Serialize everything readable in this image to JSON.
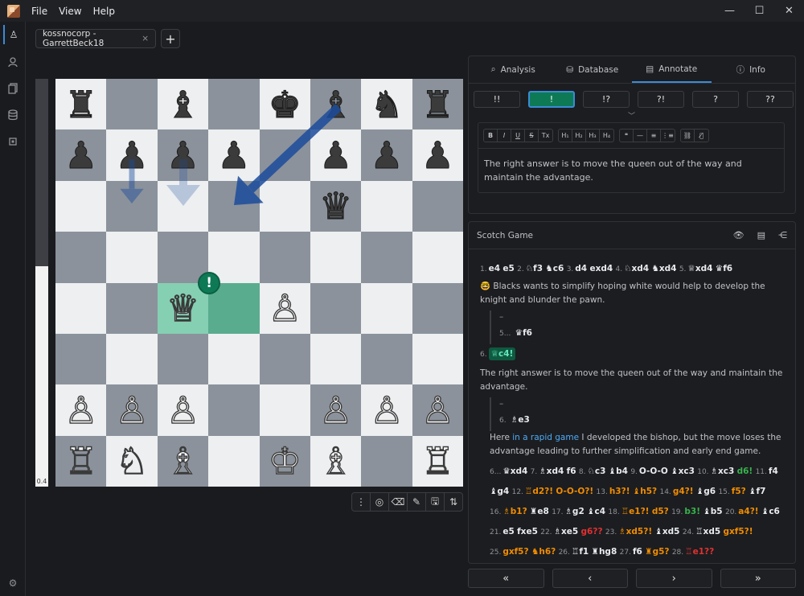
{
  "menu": [
    "File",
    "View",
    "Help"
  ],
  "tab": {
    "title": "kossnocorp - GarrettBeck18",
    "close": "×",
    "add": "+"
  },
  "eval": {
    "value": "0.4",
    "white_fraction": 0.54
  },
  "board_tools": [
    "⋮",
    "◎",
    "⌫",
    "✎",
    "🖫",
    "⇅"
  ],
  "panel": {
    "tabs": [
      {
        "icon": "⌕",
        "label": "Analysis"
      },
      {
        "icon": "⛁",
        "label": "Database"
      },
      {
        "icon": "▤",
        "label": "Annotate"
      },
      {
        "icon": "ⓘ",
        "label": "Info"
      }
    ],
    "active_tab": "Annotate",
    "nags": [
      "!!",
      "!",
      "!?",
      "?!",
      "?",
      "??"
    ],
    "selected_nag": "!",
    "editor_tools": [
      [
        "B",
        "I",
        "U",
        "S",
        "Tx"
      ],
      [
        "H₁",
        "H₂",
        "H₃",
        "H₄"
      ],
      [
        "❝",
        "—",
        "≡",
        "⋮≡"
      ],
      [
        "⛓",
        "⛓̸"
      ]
    ],
    "comment": "The right answer is to move the queen out of the way and maintain the advantage."
  },
  "game": {
    "title": "Scotch Game",
    "line1": [
      [
        "1.",
        "e4"
      ],
      [
        "",
        "e5"
      ],
      [
        "2.",
        "♘f3"
      ],
      [
        "",
        "♞c6"
      ],
      [
        "3.",
        "d4"
      ],
      [
        "",
        "exd4"
      ],
      [
        "4.",
        "♘xd4"
      ],
      [
        "",
        "♞xd4"
      ],
      [
        "5.",
        "♕xd4"
      ],
      [
        "",
        "♛f6"
      ]
    ],
    "comment1_emoji": "🤓",
    "comment1": "Blacks wants to simplify hoping white would help to develop the knight and blunder the pawn.",
    "dash": "–",
    "var1_num": "5...",
    "var1_move": "♛f6",
    "main_num": "6.",
    "main_move": "♕c4!",
    "comment2": "The right answer is to move the queen out of the way and maintain the advantage.",
    "var2_num": "6.",
    "var2_move": "♗e3",
    "comment3_pre": "Here ",
    "comment3_link": "in a rapid game",
    "comment3_post": " I developed the bishop, but the move loses the advantage leading to further simplification and early end game."
  },
  "board": {
    "arrow_color": "#1c4c9c",
    "highlight_color": "#5aac8e",
    "badge": "!"
  },
  "nav": [
    "«",
    "‹",
    "›",
    "»"
  ]
}
